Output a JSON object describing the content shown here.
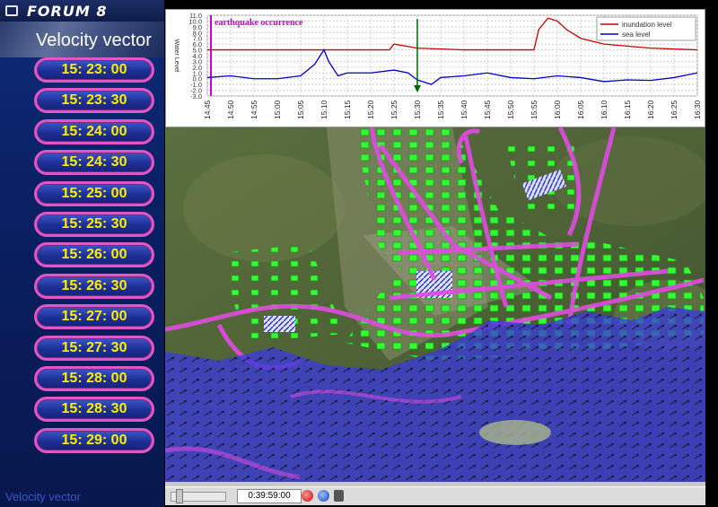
{
  "app": {
    "brand": "FORUM 8",
    "title": "Velocity vector",
    "footer": "Velocity vector"
  },
  "colors": {
    "button_text": "#ffee00",
    "button_border": "#e055c8",
    "inundation": "#cc0000",
    "sea": "#0000cc",
    "annotation": "#cc00cc",
    "marker": "#006600"
  },
  "time_buttons": [
    "15: 23: 00",
    "15: 23: 30",
    "15: 24: 00",
    "15: 24: 30",
    "15: 25: 00",
    "15: 25: 30",
    "15: 26: 00",
    "15: 26: 30",
    "15: 27: 00",
    "15: 27: 30",
    "15: 28: 00",
    "15: 28: 30",
    "15: 29: 00"
  ],
  "chart_data": {
    "type": "line",
    "annotation": "earthquake occurrence",
    "ylabel": "Water Level",
    "ylim": [
      -3.0,
      11.0
    ],
    "yticks": [
      "11.0",
      "10.0",
      "9.0",
      "8.0",
      "7.0",
      "6.0",
      "5.0",
      "4.0",
      "3.0",
      "2.0",
      "1.0",
      "0.0",
      "-1.0",
      "-2.0",
      "-3.0"
    ],
    "xticks": [
      "14:45",
      "14:50",
      "14:55",
      "15:00",
      "15:05",
      "15:10",
      "15:15",
      "15:20",
      "15:25",
      "15:30",
      "15:35",
      "15:40",
      "15:45",
      "15:50",
      "15:55",
      "16:00",
      "16:05",
      "16:10",
      "16:15",
      "16:20",
      "16:25",
      "16:30"
    ],
    "marker_time": "15:30",
    "annotation_time": "14:45",
    "series": [
      {
        "name": "inundation level",
        "color": "#cc0000",
        "x": [
          "14:45",
          "15:20",
          "15:24",
          "15:25",
          "15:30",
          "15:40",
          "15:55",
          "15:56",
          "15:58",
          "16:00",
          "16:02",
          "16:05",
          "16:10",
          "16:20",
          "16:30"
        ],
        "y": [
          5.0,
          5.0,
          5.0,
          6.0,
          5.3,
          5.0,
          5.0,
          8.5,
          10.5,
          10.0,
          8.5,
          7.0,
          6.0,
          5.3,
          5.0
        ]
      },
      {
        "name": "sea level",
        "color": "#0000cc",
        "x": [
          "14:45",
          "14:50",
          "14:55",
          "15:00",
          "15:05",
          "15:08",
          "15:10",
          "15:11",
          "15:13",
          "15:15",
          "15:20",
          "15:25",
          "15:28",
          "15:30",
          "15:33",
          "15:35",
          "15:40",
          "15:45",
          "15:50",
          "15:55",
          "16:00",
          "16:05",
          "16:10",
          "16:15",
          "16:20",
          "16:25",
          "16:30"
        ],
        "y": [
          0.2,
          0.5,
          0.0,
          0.0,
          0.5,
          2.5,
          5.0,
          3.0,
          0.5,
          1.0,
          1.0,
          1.5,
          1.0,
          -0.2,
          -1.0,
          0.2,
          0.5,
          1.0,
          0.2,
          0.0,
          0.5,
          0.2,
          -0.5,
          -0.2,
          -0.3,
          0.2,
          1.0
        ]
      }
    ]
  },
  "status": {
    "time": "0:39:59:00"
  }
}
